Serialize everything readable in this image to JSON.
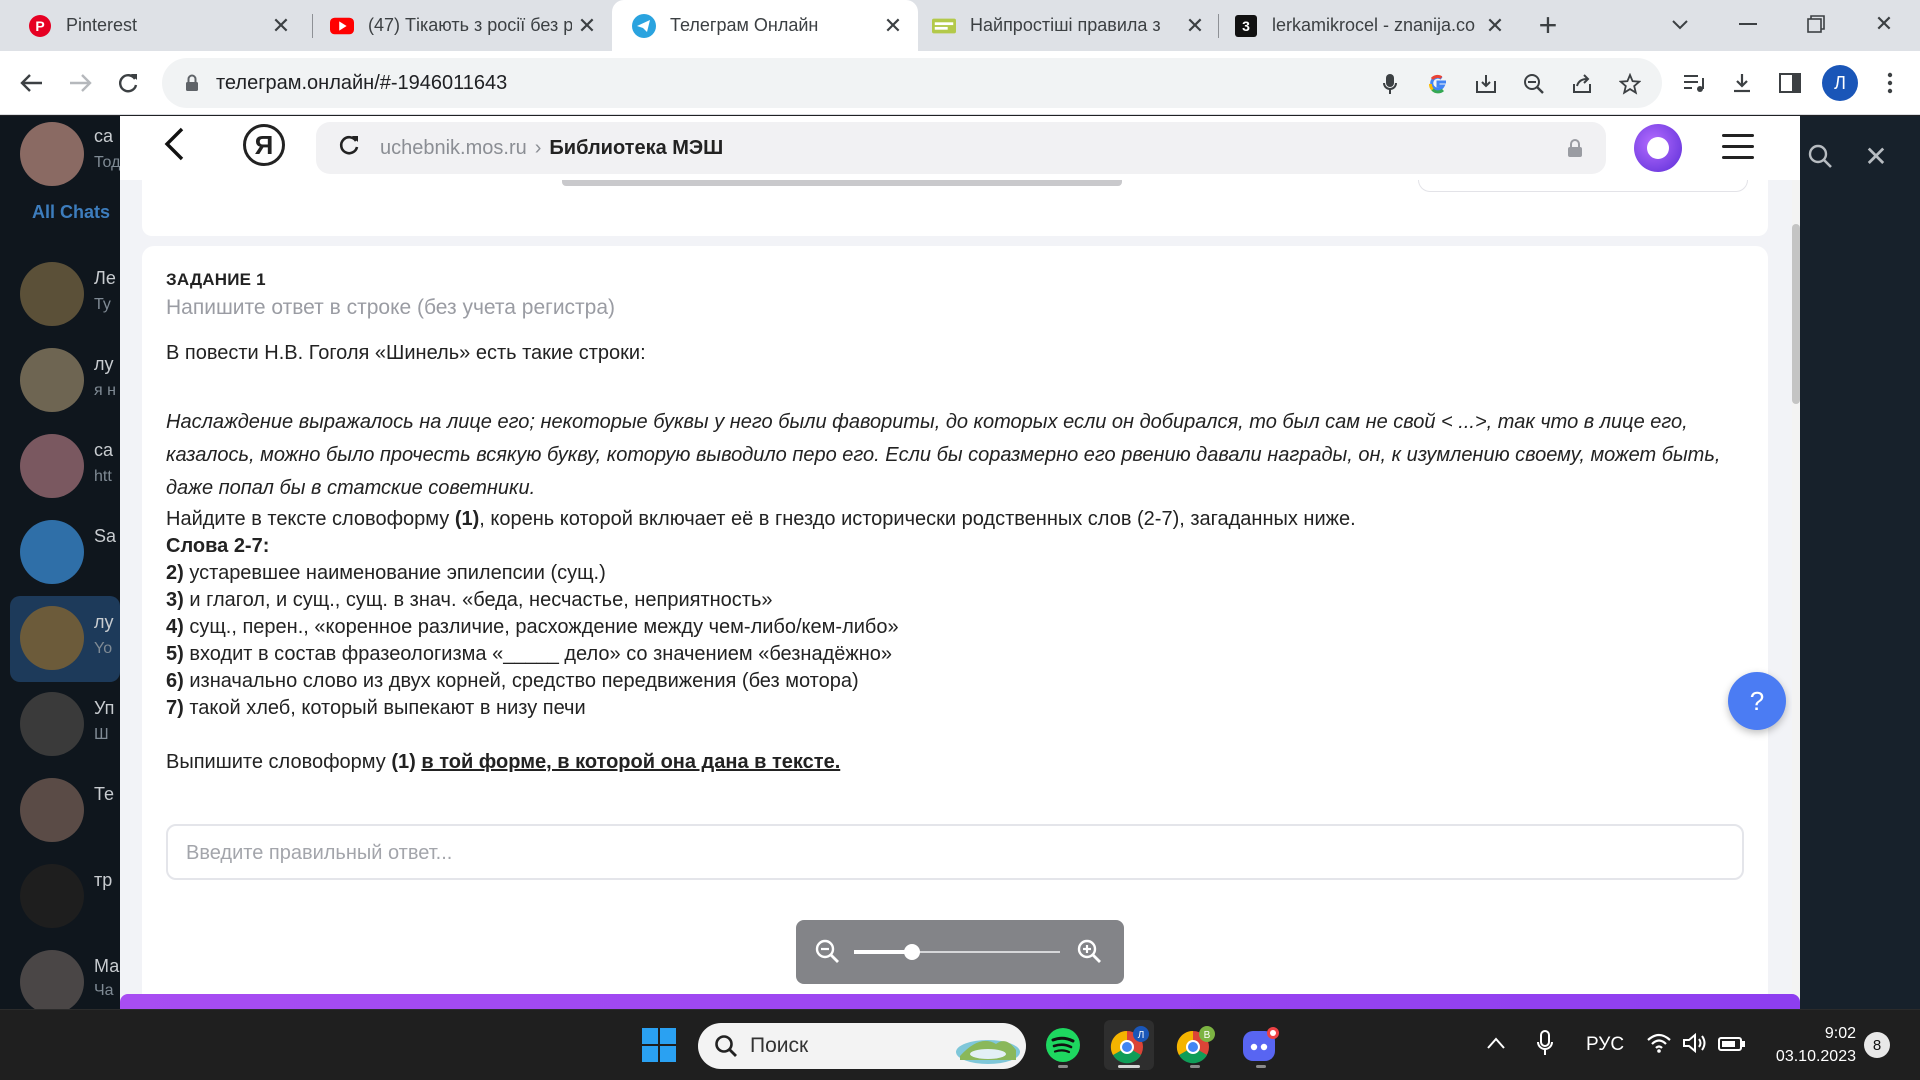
{
  "browser": {
    "tabs": [
      {
        "title": "Pinterest",
        "icon": "pinterest-icon",
        "active": false
      },
      {
        "title": "(47) Тікають з росії без р",
        "icon": "youtube-icon",
        "active": false
      },
      {
        "title": "Телеграм Онлайн",
        "icon": "telegram-icon",
        "active": true
      },
      {
        "title": "Найпростіші правила з",
        "icon": "news-icon",
        "active": false
      },
      {
        "title": "lerkamikrocel - znanija.co",
        "icon": "znanija-icon",
        "active": false
      }
    ],
    "url": "телеграм.онлайн/#-1946011643",
    "profile_initial": "Л"
  },
  "telegram": {
    "folder": "All Chats",
    "chats": [
      {
        "name": "са",
        "snippet": "Тод"
      },
      {
        "name": "Ле",
        "snippet": "Ту"
      },
      {
        "name": "лу",
        "snippet": "я н"
      },
      {
        "name": "са",
        "snippet": "htt"
      },
      {
        "name": "Sa",
        "snippet": ""
      },
      {
        "name": "лу",
        "snippet": "Yo"
      },
      {
        "name": "Уп",
        "snippet": "Ш"
      },
      {
        "name": "Те",
        "snippet": ""
      },
      {
        "name": "тр",
        "snippet": ""
      },
      {
        "name": "Ма",
        "snippet": "Ча"
      }
    ]
  },
  "screenshot": {
    "yandex": {
      "domain": "uchebnik.mos.ru",
      "crumb_separator": "›",
      "page_title": "Библиотека МЭШ",
      "logo": "Я"
    },
    "task": {
      "heading": "ЗАДАНИЕ 1",
      "hint": "Напишите ответ в строке (без учета регистра)",
      "intro": "В повести Н.В. Гоголя «Шинель» есть такие строки:",
      "quote": "Наслаждение выражалось на лице его; некоторые буквы у него были фавориты, до которых если он добирался, то был сам не свой < ...>, так что в лице его, казалось, можно было прочесть всякую букву, которую выводило перо его. Если бы соразмерно его рвению давали награды, он, к изумлению своему, может быть, даже попал бы в статские советники.",
      "instruction_prefix": "Найдите в тексте словоформу ",
      "instruction_num": "(1)",
      "instruction_suffix": ", корень которой включает её в гнездо исторически родственных слов (2-7), загаданных ниже.",
      "words_heading": "Слова 2-7:",
      "items": [
        {
          "num": "2)",
          "text": " устаревшее наименование эпилепсии (сущ.)"
        },
        {
          "num": "3)",
          "text": " и глагол, и сущ., сущ. в знач. «беда, несчастье, неприятность»"
        },
        {
          "num": "4)",
          "text": " сущ., перен., «коренное различие, расхождение между чем-либо/кем-либо»"
        },
        {
          "num": "5)",
          "text": " входит в состав фразеологизма «_____ дело» со значением «безнадёжно»"
        },
        {
          "num": "6)",
          "text": " изначально слово из двух корней, средство передвижения (без мотора)"
        },
        {
          "num": "7)",
          "text": " такой хлеб, который выпекают в низу печи"
        }
      ],
      "final_prefix": "Выпишите словоформу ",
      "final_num": "(1)",
      "final_link": "в той форме, в которой она дана в тексте.",
      "answer_placeholder": "Введите правильный ответ...",
      "help_label": "?"
    },
    "zoom_level": 0.28
  },
  "taskbar": {
    "search_placeholder": "Поиск",
    "language": "РУС",
    "time": "9:02",
    "date": "03.10.2023",
    "notifications": "8",
    "badge_chrome1": "Л",
    "badge_chrome2": "В"
  },
  "colors": {
    "accent_blue": "#4b7cf3",
    "purple": "#a84df2",
    "telegram_bg": "#17212b"
  }
}
